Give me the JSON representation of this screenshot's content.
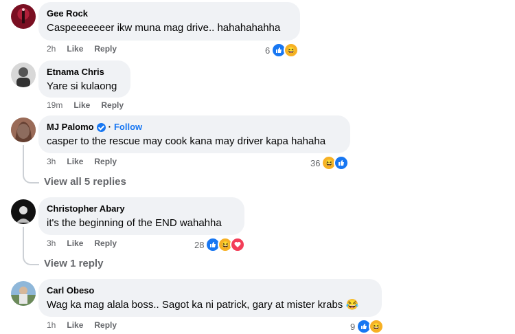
{
  "comments": [
    {
      "author": "Gee Rock",
      "text": "Caspeeeeeeer ikw muna mag drive.. hahahahahha",
      "time": "2h",
      "like_label": "Like",
      "reply_label": "Reply",
      "reaction_count": "6",
      "reactions": [
        "like-icon",
        "haha-icon"
      ]
    },
    {
      "author": "Etnama Chris",
      "text": "Yare si kulaong",
      "time": "19m",
      "like_label": "Like",
      "reply_label": "Reply"
    },
    {
      "author": "MJ Palomo",
      "verified": true,
      "follow_label": "Follow",
      "text": "casper to the rescue may cook kana may driver kapa hahaha",
      "time": "3h",
      "like_label": "Like",
      "reply_label": "Reply",
      "reaction_count": "36",
      "reactions": [
        "haha-icon",
        "like-icon"
      ],
      "view_replies": "View all 5 replies"
    },
    {
      "author": "Christopher Abary",
      "text": "it's the beginning of the END wahahha",
      "time": "3h",
      "like_label": "Like",
      "reply_label": "Reply",
      "reaction_count": "28",
      "reactions": [
        "like-icon",
        "haha-icon",
        "love-icon"
      ],
      "view_replies": "View 1 reply"
    },
    {
      "author": "Carl Obeso",
      "text": "Wag ka mag alala boss.. Sagot ka ni patrick, gary at mister krabs 😂",
      "time": "1h",
      "like_label": "Like",
      "reply_label": "Reply",
      "reaction_count": "9",
      "reactions": [
        "like-icon",
        "haha-icon"
      ]
    }
  ],
  "colors": {
    "bubble": "#f0f2f5",
    "meta": "#65676b",
    "link": "#1877f2"
  }
}
